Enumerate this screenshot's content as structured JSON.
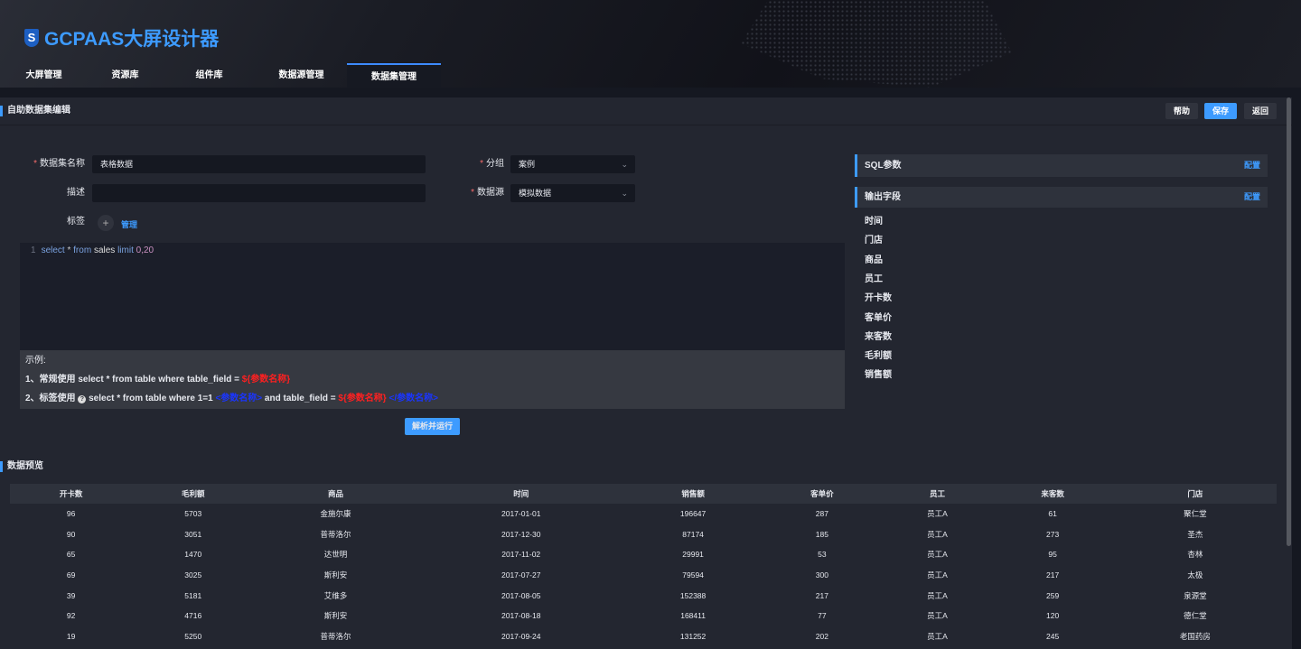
{
  "app": {
    "title": "GCPAAS大屏设计器",
    "logo_letter": "S"
  },
  "nav": {
    "tabs": [
      {
        "label": "大屏管理"
      },
      {
        "label": "资源库"
      },
      {
        "label": "组件库"
      },
      {
        "label": "数据源管理"
      },
      {
        "label": "数据集管理",
        "active": true
      }
    ]
  },
  "editor_section": {
    "title": "自助数据集编辑",
    "help": "帮助",
    "save": "保存",
    "back": "返回"
  },
  "form": {
    "name_label": "数据集名称",
    "name_value": "表格数据",
    "desc_label": "描述",
    "desc_value": "",
    "tag_label": "标签",
    "tag_manage": "管理",
    "group_label": "分组",
    "group_value": "案例",
    "source_label": "数据源",
    "source_value": "模拟数据"
  },
  "sql": {
    "line_no": "1",
    "kw_select": "select",
    "star": "*",
    "kw_from": "from",
    "table": "sales",
    "kw_limit": "limit",
    "limit_val": "0,20"
  },
  "examples": {
    "title": "示例:",
    "ex1_text": "1、常规使用 select * from table where table_field = ",
    "ex1_param": "${参数名称}",
    "ex2_prefix": "2、标签使用 ",
    "ex2_q": "?",
    "ex2_text": " select * from table where 1=1 ",
    "ex2_open": "<参数名称>",
    "ex2_mid": " and table_field = ",
    "ex2_param": "${参数名称}",
    "ex2_close": " </参数名称>"
  },
  "run_button": "解析并运行",
  "right": {
    "sql_params": "SQL参数",
    "output_fields": "输出字段",
    "config": "配置",
    "fields": [
      "时间",
      "门店",
      "商品",
      "员工",
      "开卡数",
      "客单价",
      "来客数",
      "毛利额",
      "销售额"
    ]
  },
  "preview": {
    "title": "数据预览",
    "columns": [
      "开卡数",
      "毛利额",
      "商品",
      "时间",
      "销售额",
      "客单价",
      "员工",
      "来客数",
      "门店"
    ],
    "rows": [
      [
        "96",
        "5703",
        "金施尔康",
        "2017-01-01",
        "196647",
        "287",
        "员工A",
        "61",
        "聚仁堂"
      ],
      [
        "90",
        "3051",
        "普蒂洛尔",
        "2017-12-30",
        "87174",
        "185",
        "员工A",
        "273",
        "圣杰"
      ],
      [
        "65",
        "1470",
        "达世明",
        "2017-11-02",
        "29991",
        "53",
        "员工A",
        "95",
        "杏林"
      ],
      [
        "69",
        "3025",
        "斯利安",
        "2017-07-27",
        "79594",
        "300",
        "员工A",
        "217",
        "太极"
      ],
      [
        "39",
        "5181",
        "艾维多",
        "2017-08-05",
        "152388",
        "217",
        "员工A",
        "259",
        "泉源堂"
      ],
      [
        "92",
        "4716",
        "斯利安",
        "2017-08-18",
        "168411",
        "77",
        "员工A",
        "120",
        "德仁堂"
      ],
      [
        "19",
        "5250",
        "普蒂洛尔",
        "2017-09-24",
        "131252",
        "202",
        "员工A",
        "245",
        "老国药房"
      ]
    ]
  },
  "colors": {
    "accent": "#3d9bff",
    "background": "#232630",
    "required": "#f56c6c"
  }
}
